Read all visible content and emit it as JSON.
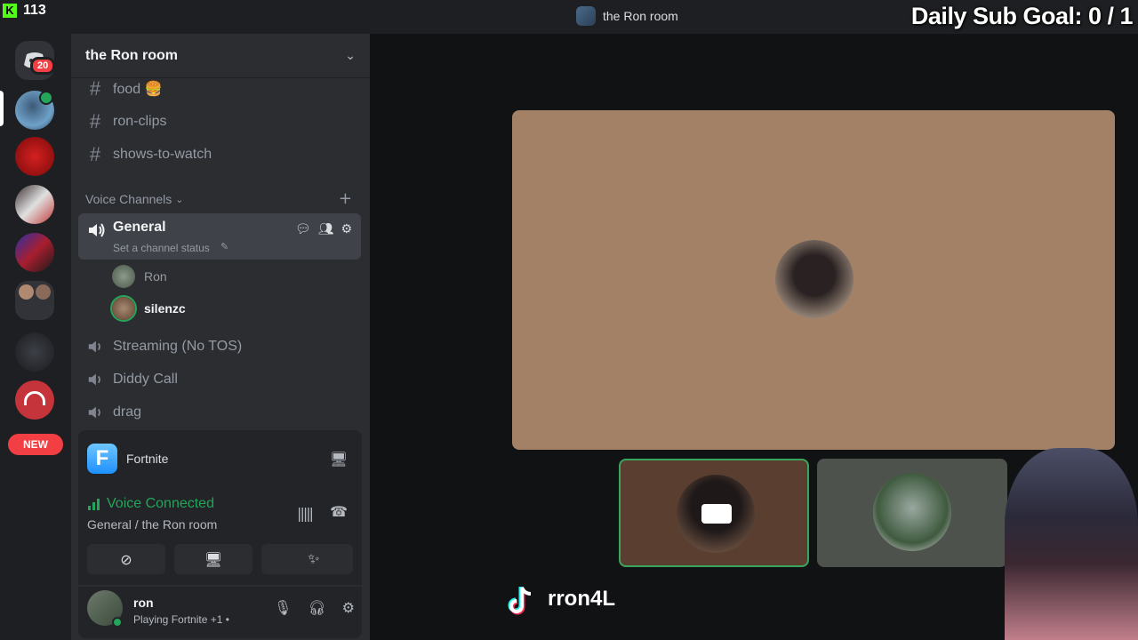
{
  "overlay": {
    "kick_logo": "K",
    "viewer_count": "113",
    "sub_goal": "Daily Sub Goal: 0 / 1"
  },
  "titlebar": {
    "title": "the Ron room"
  },
  "servers": {
    "dm_badge": "20",
    "new_label": "NEW"
  },
  "guild": {
    "name": "the Ron room",
    "text_channels": [
      {
        "name": "food 🍔"
      },
      {
        "name": "ron-clips"
      },
      {
        "name": "shows-to-watch"
      }
    ],
    "voice_category": "Voice Channels",
    "active_voice": {
      "name": "General",
      "status_placeholder": "Set a channel status",
      "members": [
        {
          "name": "Ron"
        },
        {
          "name": "silenzc"
        }
      ]
    },
    "other_voice": [
      {
        "name": "Streaming (No TOS)"
      },
      {
        "name": "Diddy Call"
      },
      {
        "name": "drag"
      }
    ]
  },
  "activity": {
    "game": "Fortnite"
  },
  "voice_status": {
    "state": "Voice Connected",
    "location": "General / the Ron room"
  },
  "user": {
    "name": "ron",
    "activity": "Playing Fortnite +1 •"
  },
  "stream": {
    "tiktok_handle": "rron4L"
  },
  "colors": {
    "accent_green": "#23a55a",
    "danger": "#f23f43",
    "panel": "#2b2d31",
    "main_tile": "#a38166"
  }
}
